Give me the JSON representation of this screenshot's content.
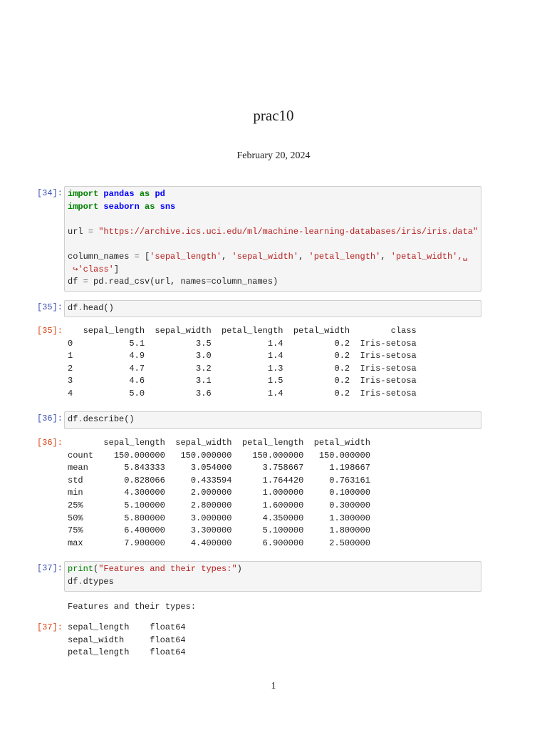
{
  "title": "prac10",
  "date": "February 20, 2024",
  "page_number": "1",
  "cells": [
    {
      "prompt": "[34]:",
      "lines": [
        [
          {
            "t": "import",
            "c": "kw"
          },
          {
            "t": " "
          },
          {
            "t": "pandas",
            "c": "nm"
          },
          {
            "t": " "
          },
          {
            "t": "as",
            "c": "kw"
          },
          {
            "t": " "
          },
          {
            "t": "pd",
            "c": "nm"
          }
        ],
        [
          {
            "t": "import",
            "c": "kw"
          },
          {
            "t": " "
          },
          {
            "t": "seaborn",
            "c": "nm"
          },
          {
            "t": " "
          },
          {
            "t": "as",
            "c": "kw"
          },
          {
            "t": " "
          },
          {
            "t": "sns",
            "c": "nm"
          }
        ],
        [],
        [
          {
            "t": "url "
          },
          {
            "t": "=",
            "c": "op"
          },
          {
            "t": " "
          },
          {
            "t": "\"https://archive.ics.uci.edu/ml/machine-learning-databases/iris/iris.data\"",
            "c": "st"
          }
        ],
        [],
        [
          {
            "t": "column_names "
          },
          {
            "t": "=",
            "c": "op"
          },
          {
            "t": " ["
          },
          {
            "t": "'sepal_length'",
            "c": "st"
          },
          {
            "t": ", "
          },
          {
            "t": "'sepal_width'",
            "c": "st"
          },
          {
            "t": ", "
          },
          {
            "t": "'petal_length'",
            "c": "st"
          },
          {
            "t": ", "
          },
          {
            "t": "'petal_width'",
            "c": "st"
          },
          {
            "t": ",␣",
            "c": "cont"
          }
        ],
        [
          {
            "t": " ↪",
            "c": "cont"
          },
          {
            "t": "'class'",
            "c": "st"
          },
          {
            "t": "]"
          }
        ],
        [
          {
            "t": "df "
          },
          {
            "t": "=",
            "c": "op"
          },
          {
            "t": " pd"
          },
          {
            "t": ".",
            "c": "op"
          },
          {
            "t": "read_csv(url, names"
          },
          {
            "t": "=",
            "c": "op"
          },
          {
            "t": "column_names)"
          }
        ]
      ]
    },
    {
      "prompt": "[35]:",
      "lines": [
        [
          {
            "t": "df"
          },
          {
            "t": ".",
            "c": "op"
          },
          {
            "t": "head()"
          }
        ]
      ],
      "output_prompt": "[35]:",
      "output": {
        "columns": [
          "",
          "sepal_length",
          "sepal_width",
          "petal_length",
          "petal_width",
          "class"
        ],
        "index_align": "left",
        "rows": [
          [
            "0",
            "5.1",
            "3.5",
            "1.4",
            "0.2",
            "Iris-setosa"
          ],
          [
            "1",
            "4.9",
            "3.0",
            "1.4",
            "0.2",
            "Iris-setosa"
          ],
          [
            "2",
            "4.7",
            "3.2",
            "1.3",
            "0.2",
            "Iris-setosa"
          ],
          [
            "3",
            "4.6",
            "3.1",
            "1.5",
            "0.2",
            "Iris-setosa"
          ],
          [
            "4",
            "5.0",
            "3.6",
            "1.4",
            "0.2",
            "Iris-setosa"
          ]
        ]
      }
    },
    {
      "prompt": "[36]:",
      "lines": [
        [
          {
            "t": "df"
          },
          {
            "t": ".",
            "c": "op"
          },
          {
            "t": "describe()"
          }
        ]
      ],
      "output_prompt": "[36]:",
      "output": {
        "columns": [
          "",
          "sepal_length",
          "sepal_width",
          "petal_length",
          "petal_width"
        ],
        "index_align": "left",
        "rows": [
          [
            "count",
            "150.000000",
            "150.000000",
            "150.000000",
            "150.000000"
          ],
          [
            "mean",
            "5.843333",
            "3.054000",
            "3.758667",
            "1.198667"
          ],
          [
            "std",
            "0.828066",
            "0.433594",
            "1.764420",
            "0.763161"
          ],
          [
            "min",
            "4.300000",
            "2.000000",
            "1.000000",
            "0.100000"
          ],
          [
            "25%",
            "5.100000",
            "2.800000",
            "1.600000",
            "0.300000"
          ],
          [
            "50%",
            "5.800000",
            "3.000000",
            "4.350000",
            "1.300000"
          ],
          [
            "75%",
            "6.400000",
            "3.300000",
            "5.100000",
            "1.800000"
          ],
          [
            "max",
            "7.900000",
            "4.400000",
            "6.900000",
            "2.500000"
          ]
        ]
      }
    },
    {
      "prompt": "[37]:",
      "lines": [
        [
          {
            "t": "print",
            "c": "kw2"
          },
          {
            "t": "("
          },
          {
            "t": "\"Features and their types:\"",
            "c": "st"
          },
          {
            "t": ")"
          }
        ],
        [
          {
            "t": "df"
          },
          {
            "t": ".",
            "c": "op"
          },
          {
            "t": "dtypes"
          }
        ]
      ],
      "stdout": "Features and their types:",
      "output_prompt": "[37]:",
      "output": {
        "series": [
          [
            "sepal_length",
            "float64"
          ],
          [
            "sepal_width",
            "float64"
          ],
          [
            "petal_length",
            "float64"
          ]
        ]
      }
    }
  ]
}
